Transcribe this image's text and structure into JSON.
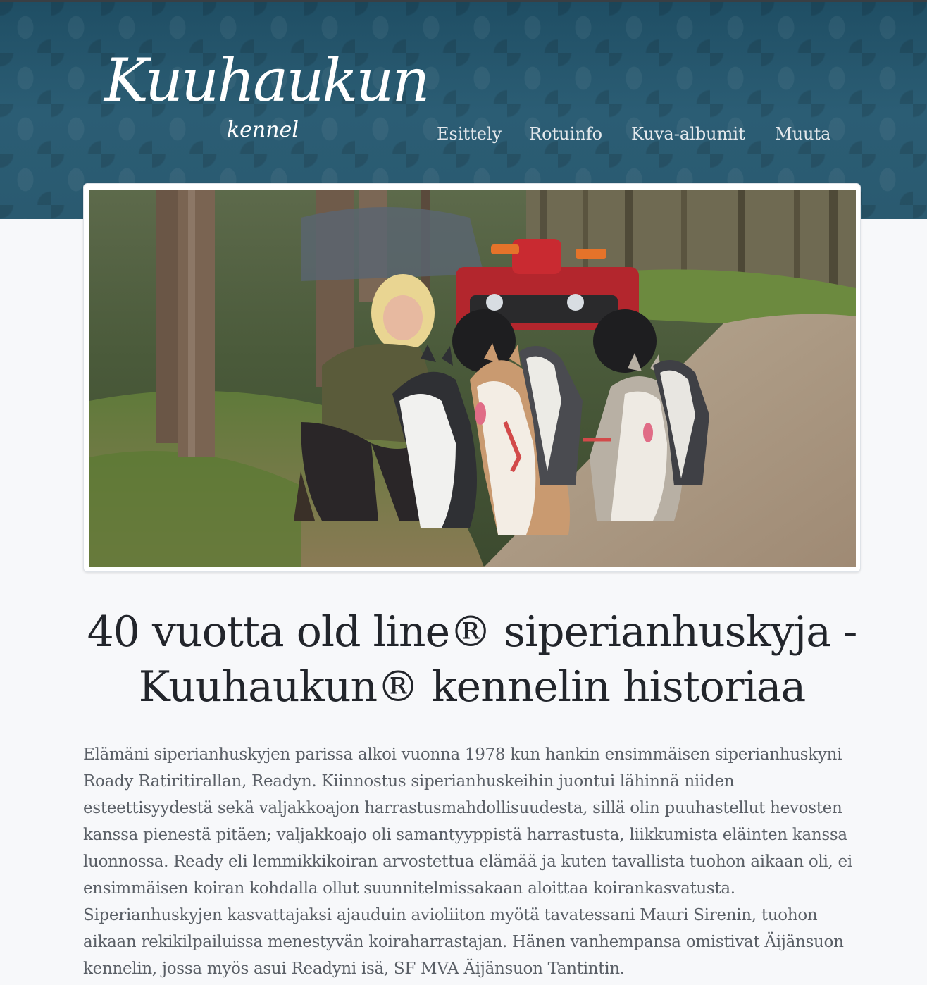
{
  "site": {
    "logo_text": "Kuuhaukun",
    "logo_subtext": "kennel"
  },
  "nav": {
    "items": [
      {
        "label": "Esittely"
      },
      {
        "label": "Rotuinfo"
      },
      {
        "label": "Kuva-albumit"
      },
      {
        "label": "Muuta"
      }
    ]
  },
  "colors": {
    "header_bg": "#27576e",
    "page_bg": "#f7f8fa",
    "headline": "#22252b",
    "body_text": "#5a5f66"
  },
  "article": {
    "title_line1": "40 vuotta old line® siperianhuskyja -",
    "title_line2": "Kuuhaukun® kennelin historiaa",
    "paragraph": "Elämäni siperianhuskyjen parissa alkoi vuonna 1978 kun hankin ensimmäisen siperianhuskyni Roady Ratiritirallan, Readyn. Kiinnostus siperianhuskeihin juontui lähinnä niiden esteettisyydestä sekä valjakkoajon harrastusmahdollisuudesta, sillä olin puuhastellut hevosten kanssa pienestä pitäen; valjakkoajo oli samantyyppistä harrastusta, liikkumista eläinten kanssa luonnossa. Ready eli lemmikkikoiran arvostettua elämää ja kuten tavallista tuohon aikaan oli, ei ensimmäisen koiran kohdalla ollut suunnitelmissakaan aloittaa koirankasvatusta. Siperianhuskyjen kasvattajaksi ajauduin avioliiton myötä tavatessani Mauri Sirenin, tuohon aikaan rekikilpailuissa menestyvän koiraharrastajan. Hänen vanhempansa omistivat Äijänsuon kennelin, jossa myös asui Readyni isä, SF MVA Äijänsuon Tantintin."
  }
}
